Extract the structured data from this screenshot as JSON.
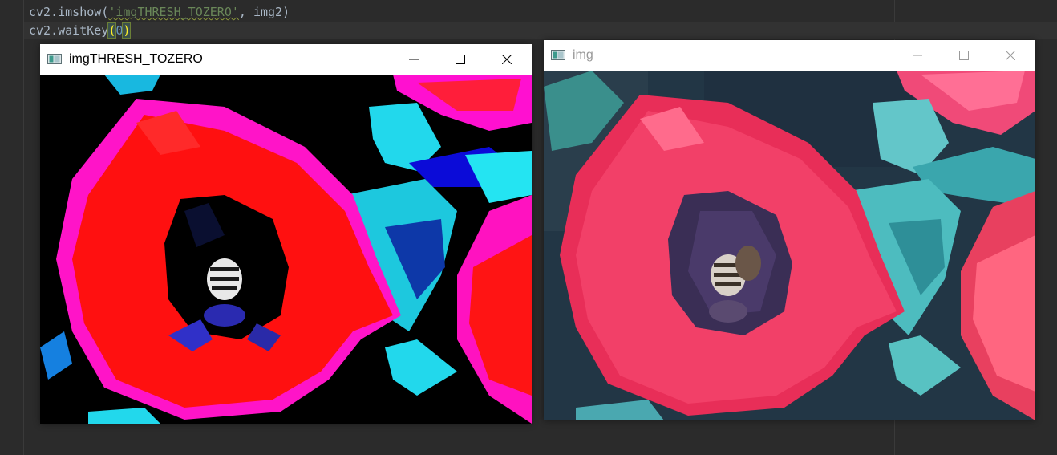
{
  "editor": {
    "line1": {
      "prefix": "cv2.imshow(",
      "string": "'imgTHRESH_TOZERO'",
      "suffix": ", img2)"
    },
    "line2": {
      "prefix": "cv2.waitKey",
      "open": "(",
      "arg": "0",
      "close": ")"
    }
  },
  "windows": [
    {
      "title": "imgTHRESH_TOZERO",
      "active": true,
      "icon": "opencv-window-icon",
      "image": "thresholded tulip with bee (high-contrast red, black, cyan)"
    },
    {
      "title": "img",
      "active": false,
      "icon": "opencv-window-icon",
      "image": "original tulip with bee photo"
    }
  ],
  "controls": {
    "minimize": "minimize-icon",
    "maximize": "maximize-icon",
    "close": "close-icon"
  },
  "colors": {
    "editor_bg": "#2b2b2b",
    "code_text": "#a9b7c6",
    "string": "#6a8759",
    "number": "#6897bb",
    "paren_match": "#ffef28",
    "tozero_red": "#ff1010",
    "tozero_cyan": "#20e0f0",
    "orig_pink": "#f0305a",
    "orig_teal": "#4fbfc0"
  }
}
